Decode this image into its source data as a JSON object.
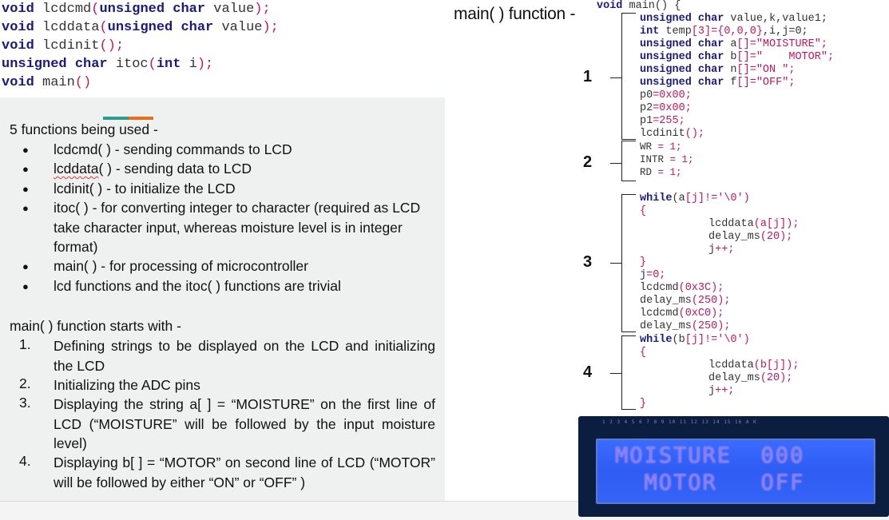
{
  "prototypes": {
    "line1": {
      "kw1": "void",
      "name": "lcdcmd",
      "open": "(",
      "kw2": "unsigned char",
      "arg": " value",
      "close": ");"
    },
    "line2": {
      "kw1": "void",
      "name": "lcddata",
      "open": "(",
      "kw2": "unsigned char",
      "arg": " value",
      "close": ");"
    },
    "line3": {
      "kw1": "void",
      "name": "lcdinit",
      "close": "();"
    },
    "line4": {
      "kw1": "unsigned char",
      "name": "itoc",
      "open": "(",
      "kw2": "int",
      "arg": " i",
      "close": ");"
    },
    "line5": {
      "kw1": "void",
      "name": "main",
      "close": "()"
    }
  },
  "functions_section": {
    "heading": "5 functions being used -",
    "items": [
      "lcdcmd( ) - sending commands to LCD",
      "lcddata( ) -  sending data to LCD",
      "lcdinit( ) - to initialize the LCD",
      "itoc( ) - for converting integer to character (required as LCD  take character input, whereas moisture level is in integer format)",
      "main( ) - for processing of microcontroller",
      "lcd functions and the itoc( ) functions are trivial"
    ],
    "item2_word": "lcddata",
    "item2_rest": "( ) -  sending data to LCD"
  },
  "main_section": {
    "heading": "main( ) function starts with -",
    "steps": [
      {
        "num": "1.",
        "text": "Defining strings to be displayed on the LCD and initializing the LCD"
      },
      {
        "num": "2.",
        "text": "Initializing the ADC pins"
      },
      {
        "num": "3.",
        "text": "Displaying the string a[ ] = “MOISTURE” on the first line of LCD (“MOISTURE” will be followed by the input moisture level)"
      },
      {
        "num": "4.",
        "text": "Displaying b[  ] = “MOTOR” on second line of LCD (“MOTOR” will be followed by either “ON” or “OFF” )"
      }
    ]
  },
  "code_panel": {
    "label": "main( ) function -",
    "markers": [
      "1",
      "2",
      "3",
      "4"
    ],
    "lines": {
      "l01_kw": "void",
      "l01_rest": " main() {",
      "l02_kw": "unsigned char",
      "l02_rest": " value,k,value1;",
      "l03_kw": "int",
      "l03_a": " temp",
      "l03_b": "[3]={0,0,0}",
      "l03_c": ",i,j=0;",
      "l04_kw": "unsigned char",
      "l04_a": " a",
      "l04_b": "[]=\"MOISTURE\";",
      "l05_kw": "unsigned char",
      "l05_a": " b",
      "l05_b": "[]=\"    MOTOR\";",
      "l06_kw": "unsigned char",
      "l06_a": " n",
      "l06_b": "[]=\"ON \";",
      "l07_kw": "unsigned char",
      "l07_a": " f",
      "l07_b": "[]=\"OFF\";",
      "l08_a": "p0",
      "l08_b": "=0x00;",
      "l09_a": "p2",
      "l09_b": "=0x00;",
      "l10_a": "p1",
      "l10_b": "=255;",
      "l11_a": "lcdinit",
      "l11_b": "();",
      "l12_a": "WR",
      "l12_b": " = 1;",
      "l13_a": "INTR",
      "l13_b": " = 1;",
      "l14_a": "RD",
      "l14_b": " = 1;",
      "l15_kw": "while",
      "l15_a": "(a",
      "l15_b": "[j]!='\\0')",
      "l16": "{",
      "l17_a": "lcddata",
      "l17_b": "(a[j]);",
      "l18_a": "delay_ms",
      "l18_b": "(20);",
      "l19_a": "j",
      "l19_b": "++;",
      "l20": "}",
      "l21_a": "j",
      "l21_b": "=0;",
      "l22_a": "lcdcmd",
      "l22_b": "(0x3C);",
      "l23_a": "delay_ms",
      "l23_b": "(250);",
      "l24_a": "lcdcmd",
      "l24_b": "(0xC0);",
      "l25_a": "delay_ms",
      "l25_b": "(250);",
      "l26_kw": "while",
      "l26_a": "(b",
      "l26_b": "[j]!='\\0')",
      "l27": "{",
      "l28_a": "lcddata",
      "l28_b": "(b[j]);",
      "l29_a": "delay_ms",
      "l29_b": "(20);",
      "l30_a": "j",
      "l30_b": "++;",
      "l31": "}"
    }
  },
  "lcd_photo": {
    "line1": "MOISTURE  000",
    "line2": "  MOTOR   OFF",
    "pin_labels": "1 2 3 4 5 6 7 8 9 10 11 12 13 14 15 16 A K"
  },
  "colors": {
    "keyword": "#1a1a80",
    "symbol": "#c2185b",
    "panel_bg": "#eff0f0",
    "accent_teal": "#2a9d8f",
    "accent_orange": "#e76f1b",
    "lcd_background": "#3564f7",
    "lcd_text": "#8d7cf0"
  }
}
